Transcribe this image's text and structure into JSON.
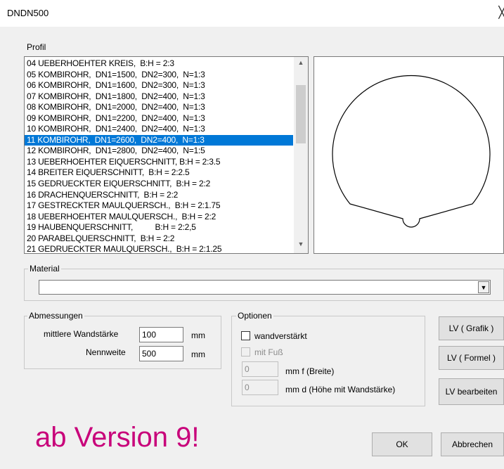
{
  "window": {
    "title": "DNDN500",
    "close_glyph": "╳"
  },
  "profile": {
    "label": "Profil",
    "items": [
      "04 UEBERHOEHTER KREIS,  B:H = 2:3",
      "05 KOMBIROHR,  DN1=1500,  DN2=300,  N=1:3",
      "06 KOMBIROHR,  DN1=1600,  DN2=300,  N=1:3",
      "07 KOMBIROHR,  DN1=1800,  DN2=400,  N=1:3",
      "08 KOMBIROHR,  DN1=2000,  DN2=400,  N=1:3",
      "09 KOMBIROHR,  DN1=2200,  DN2=400,  N=1:3",
      "10 KOMBIROHR,  DN1=2400,  DN2=400,  N=1:3",
      "11 KOMBIROHR,  DN1=2600,  DN2=400,  N=1:3",
      "12 KOMBIROHR,  DN1=2800,  DN2=400,  N=1:5",
      "13 UEBERHOEHTER EIQUERSCHNITT, B:H = 2:3.5",
      "14 BREITER EIQUERSCHNITT,  B:H = 2:2.5",
      "15 GEDRUECKTER EIQUERSCHNITT,  B:H = 2:2",
      "16 DRACHENQUERSCHNITT,  B:H = 2:2",
      "17 GESTRECKTER MAULQUERSCH.,  B:H = 2:1.75",
      "18 UEBERHOEHTER MAULQUERSCH.,  B:H = 2:2",
      "19 HAUBENQUERSCHNITT,          B:H = 2:2,5",
      "20 PARABELQUERSCHNITT,  B:H = 2:2",
      "21 GEDRUECKTER MAULQUERSCH.,  B:H = 2:1.25"
    ],
    "selected_index": 7,
    "scroll_up_glyph": "▲",
    "scroll_down_glyph": "▼"
  },
  "material": {
    "label": "Material",
    "value": "",
    "drop_glyph": "▼"
  },
  "abmessungen": {
    "label": "Abmessungen",
    "wandstaerke_label": "mittlere Wandstärke",
    "wandstaerke_value": "100",
    "wandstaerke_unit": "mm",
    "nennweite_label": "Nennweite",
    "nennweite_value": "500",
    "nennweite_unit": "mm"
  },
  "optionen": {
    "label": "Optionen",
    "wandverstaerkt": "wandverstärkt",
    "mit_fuss": "mit Fuß",
    "f_value": "0",
    "f_label": "mm  f  (Breite)",
    "d_value": "0",
    "d_label": "mm  d (Höhe mit Wandstärke)"
  },
  "buttons": {
    "lv_grafik": "LV ( Grafik )",
    "lv_formel": "LV ( Formel )",
    "lv_bearbeiten": "LV bearbeiten",
    "ok": "OK",
    "abbrechen": "Abbrechen"
  },
  "promo": "ab Version 9!",
  "colors": {
    "selection": "#0078d7",
    "promo": "#c8007a"
  }
}
